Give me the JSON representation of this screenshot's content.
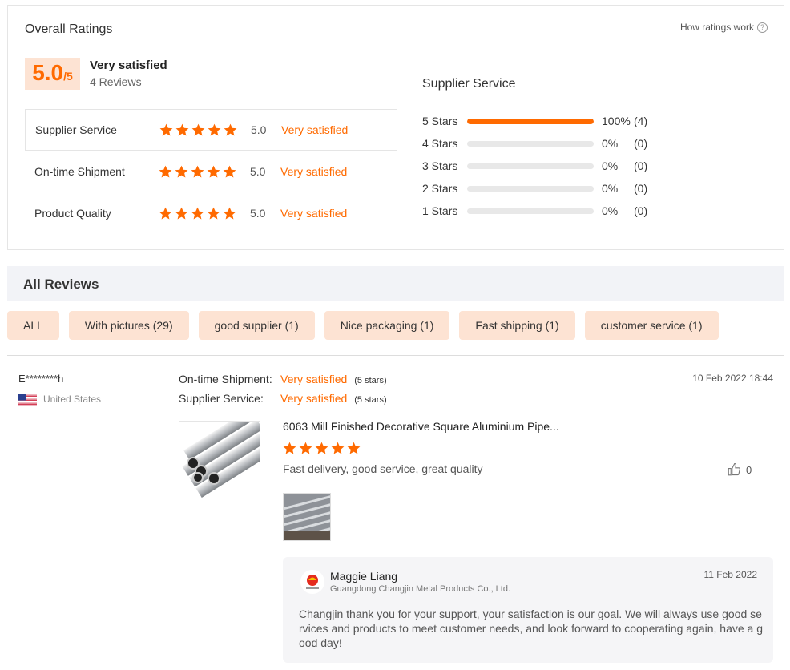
{
  "ratings": {
    "title": "Overall Ratings",
    "how_link": "How ratings work",
    "help_glyph": "?",
    "score": "5.0",
    "score_denominator": "/5",
    "satisfaction": "Very satisfied",
    "review_count": "4 Reviews",
    "criteria": [
      {
        "label": "Supplier Service",
        "score": "5.0",
        "text": "Very satisfied",
        "stars": 5
      },
      {
        "label": "On-time Shipment",
        "score": "5.0",
        "text": "Very satisfied",
        "stars": 5
      },
      {
        "label": "Product Quality",
        "score": "5.0",
        "text": "Very satisfied",
        "stars": 5
      }
    ],
    "distribution": {
      "title": "Supplier Service",
      "rows": [
        {
          "label": "5  Stars",
          "fraction": 1.0,
          "pct": "100%",
          "count": "(4)"
        },
        {
          "label": "4  Stars",
          "fraction": 0,
          "pct": "0%",
          "count": "(0)"
        },
        {
          "label": "3  Stars",
          "fraction": 0,
          "pct": "0%",
          "count": "(0)"
        },
        {
          "label": "2  Stars",
          "fraction": 0,
          "pct": "0%",
          "count": "(0)"
        },
        {
          "label": "1  Stars",
          "fraction": 0,
          "pct": "0%",
          "count": "(0)"
        }
      ]
    }
  },
  "reviews_section": {
    "title": "All Reviews",
    "filters": [
      "ALL",
      "With pictures (29)",
      "good supplier (1)",
      "Nice packaging (1)",
      "Fast shipping (1)",
      "customer service (1)"
    ]
  },
  "review": {
    "reviewer": "E********h",
    "country": "United States",
    "date": "10 Feb 2022 18:44",
    "shipment_label": "On-time Shipment:",
    "shipment_value": "Very satisfied",
    "shipment_stars": "(5 stars)",
    "service_label": "Supplier Service:",
    "service_value": "Very satisfied",
    "service_stars": "(5 stars)",
    "product_name": "6063 Mill Finished Decorative Square Aluminium Pipe...",
    "rating": 5,
    "text": "Fast delivery, good service, great quality",
    "likes": "0",
    "reply": {
      "name": "Maggie Liang",
      "company": "Guangdong Changjin Metal Products Co., Ltd.",
      "date": "11 Feb 2022",
      "text": "Changjin thank you for your support, your satisfaction is our goal. We will always use good services and products to meet customer needs, and look forward to cooperating again, have a good day!"
    }
  },
  "colors": {
    "accent": "#ff6a00",
    "chip_bg": "#fde3d3",
    "header_bg": "#f2f3f7"
  },
  "icons": {
    "star": "star-icon",
    "help": "help-circle-icon",
    "like": "thumbs-up-icon",
    "flag": "us-flag-icon"
  }
}
